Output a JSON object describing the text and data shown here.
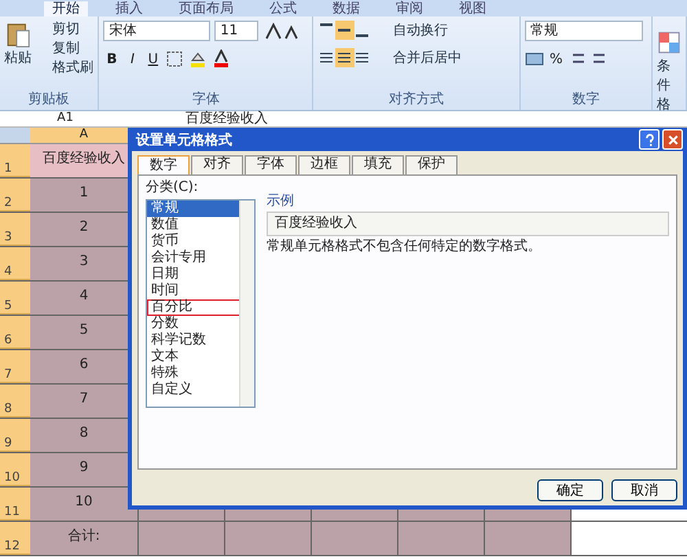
{
  "ribbon": {
    "tabs": [
      {
        "label": "开始",
        "selected": true
      },
      {
        "label": "插入",
        "selected": false
      },
      {
        "label": "页面布局",
        "selected": false
      },
      {
        "label": "公式",
        "selected": false
      },
      {
        "label": "数据",
        "selected": false
      },
      {
        "label": "审阅",
        "selected": false
      },
      {
        "label": "视图",
        "selected": false
      }
    ],
    "clipboard": {
      "paste": "粘贴",
      "items": [
        "剪切",
        "复制",
        "格式刷"
      ],
      "label": "剪贴板"
    },
    "font": {
      "name": "宋体",
      "size": "11",
      "bold": "B",
      "italic": "I",
      "underline": "U",
      "label": "字体"
    },
    "alignment": {
      "wrap": "自动换行",
      "merge": "合并后居中",
      "label": "对齐方式"
    },
    "number": {
      "format": "常规",
      "percent": "%",
      "label": "数字"
    },
    "styles": {
      "conditional": "条件格"
    }
  },
  "formula_bar": {
    "name_box": "A1",
    "value": "百度经验收入"
  },
  "sheet": {
    "columns": [
      "A"
    ],
    "rows": [
      {
        "number": "1",
        "value": "百度经验收入"
      },
      {
        "number": "2",
        "value": "1"
      },
      {
        "number": "3",
        "value": "2"
      },
      {
        "number": "4",
        "value": "3"
      },
      {
        "number": "5",
        "value": "4"
      },
      {
        "number": "6",
        "value": "5"
      },
      {
        "number": "7",
        "value": "6"
      },
      {
        "number": "8",
        "value": "7"
      },
      {
        "number": "9",
        "value": "8"
      },
      {
        "number": "10",
        "value": "9"
      },
      {
        "number": "11",
        "value": "10"
      },
      {
        "number": "12",
        "value": "合计:"
      }
    ]
  },
  "dialog": {
    "title": "设置单元格格式",
    "tabs": [
      {
        "label": "数字",
        "selected": true
      },
      {
        "label": "对齐",
        "selected": false
      },
      {
        "label": "字体",
        "selected": false
      },
      {
        "label": "边框",
        "selected": false
      },
      {
        "label": "填充",
        "selected": false
      },
      {
        "label": "保护",
        "selected": false
      }
    ],
    "category_label": "分类(C):",
    "categories": [
      {
        "label": "常规",
        "selected": true,
        "highlighted": false
      },
      {
        "label": "数值",
        "selected": false,
        "highlighted": false
      },
      {
        "label": "货币",
        "selected": false,
        "highlighted": false
      },
      {
        "label": "会计专用",
        "selected": false,
        "highlighted": false
      },
      {
        "label": "日期",
        "selected": false,
        "highlighted": false
      },
      {
        "label": "时间",
        "selected": false,
        "highlighted": false
      },
      {
        "label": "百分比",
        "selected": false,
        "highlighted": true
      },
      {
        "label": "分数",
        "selected": false,
        "highlighted": false
      },
      {
        "label": "科学记数",
        "selected": false,
        "highlighted": false
      },
      {
        "label": "文本",
        "selected": false,
        "highlighted": false
      },
      {
        "label": "特殊",
        "selected": false,
        "highlighted": false
      },
      {
        "label": "自定义",
        "selected": false,
        "highlighted": false
      }
    ],
    "sample_label": "示例",
    "sample": "百度经验收入",
    "description": "常规单元格格式不包含任何特定的数字格式。",
    "buttons": [
      "确定",
      "取消"
    ]
  }
}
